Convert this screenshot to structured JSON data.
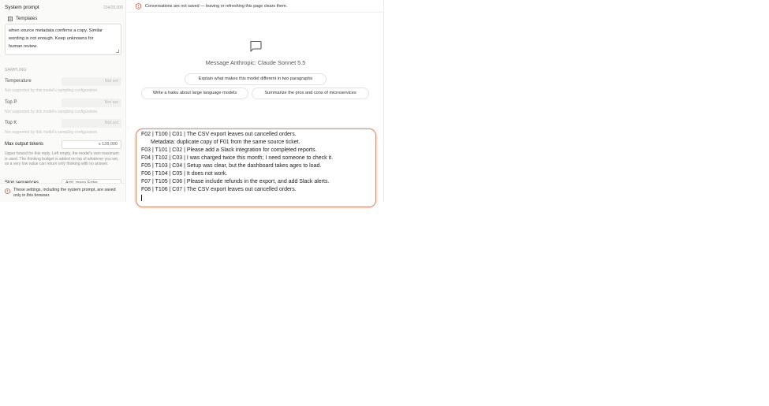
{
  "sidebar": {
    "system_prompt_label": "System prompt",
    "char_count": "234/20,000",
    "templates_label": "Templates",
    "system_prompt_text": "Anthropic-supported facts from duplicates only\nwhen source metadata confirms a copy. Similar\nwording is not enough. Keep unknowns for\nhuman review.",
    "sampling_label": "SAMPLING",
    "temperature": {
      "label": "Temperature",
      "value": "Not set",
      "hint": "Not supported by this model's sampling configuration."
    },
    "top_p": {
      "label": "Top P",
      "value": "Not set",
      "hint": "Not supported by this model's sampling configuration."
    },
    "top_k": {
      "label": "Top K",
      "value": "Not set",
      "hint": "Not supported by this model's sampling configuration."
    },
    "max_output": {
      "label": "Max output tokens",
      "value": "≤ 128,000",
      "help": "Upper bound for this reply. Left empty, the model's own maximum is used. The thinking budget is added on top of whatever you set, so a very low value can return only thinking with no answer."
    },
    "stop_sequences": {
      "label": "Stop sequences",
      "placeholder": "Add, press Enter"
    },
    "footer_note": "These settings, including the system prompt, are saved only in this browser."
  },
  "main": {
    "banner": "Conversations are not saved — leaving or refreshing this page clears them.",
    "empty_title": "Message Anthropic: Claude Sonnet 5.5",
    "suggestions": [
      "Explain what makes this model different in two paragraphs",
      "Write a haiku about large language models",
      "Summarize the pros and cons of microservices"
    ],
    "composer_lines": [
      "F02 | T100 | C01 | The CSV export leaves out cancelled orders.",
      "Metadata: duplicate copy of F01 from the same source ticket.",
      "F03 | T101 | C02 | Please add a Slack integration for completed reports.",
      "F04 | T102 | C03 | I was charged twice this month; I need someone to check it.",
      "F05 | T103 | C04 | Setup was clear, but the dashboard takes ages to load.",
      "F06 | T104 | C05 | It does not work.",
      "F07 | T105 | C06 | Please include refunds in the export, and add Slack alerts.",
      "F08 | T106 | C07 | The CSV export leaves out cancelled orders."
    ]
  },
  "colors": {
    "accent": "#d98a63",
    "warning": "#e0533d"
  }
}
